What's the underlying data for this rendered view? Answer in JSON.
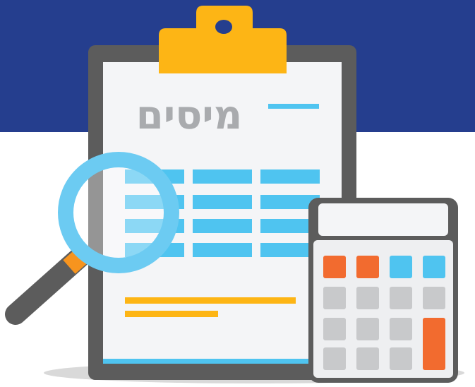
{
  "illustration": {
    "title": "מיסים",
    "colors": {
      "banner": "#253e8e",
      "paper": "#f4f5f7",
      "board": "#5c5c5c",
      "clip": "#fdb515",
      "cyan": "#4fc4f0",
      "yellow": "#fdb515",
      "orange": "#f26b2f",
      "key_gray": "#c8c9cb",
      "title_gray": "#a9abae"
    },
    "icons": [
      "clipboard-icon",
      "magnifying-glass-icon",
      "calculator-icon"
    ]
  }
}
